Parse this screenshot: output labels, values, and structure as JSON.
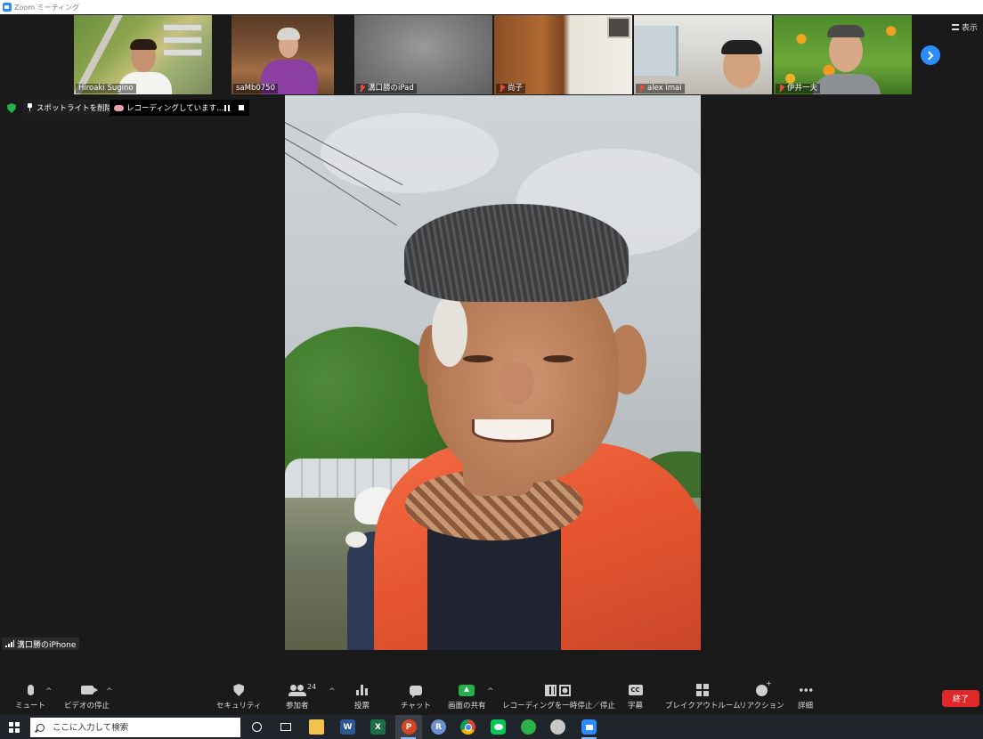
{
  "window": {
    "title": "Zoom ミーティング"
  },
  "participants": [
    {
      "name": "Hiroaki Sugino",
      "muted": false
    },
    {
      "name": "saMb0750",
      "muted": false
    },
    {
      "name": "溝口勝のiPad",
      "muted": true
    },
    {
      "name": "尚子",
      "muted": true
    },
    {
      "name": "alex imai",
      "muted": true
    },
    {
      "name": "伊井一夫",
      "muted": true
    }
  ],
  "view_button": {
    "label": "表示"
  },
  "spotlight": {
    "remove_label": "スポットライトを削除"
  },
  "recording": {
    "status": "レコーディングしています..."
  },
  "active_speaker": {
    "name": "溝口勝のiPhone"
  },
  "toolbar": {
    "mute": "ミュート",
    "stop_video": "ビデオの停止",
    "security": "セキュリティ",
    "participants": "参加者",
    "participant_count": "24",
    "polls": "投票",
    "chat": "チャット",
    "share": "画面の共有",
    "recording_control": "レコーディングを一時停止／停止",
    "captions": "字幕",
    "captions_icon_text": "CC",
    "breakout": "ブレイクアウトルーム",
    "reactions": "リアクション",
    "more": "詳細",
    "end": "終了"
  },
  "taskbar": {
    "search_placeholder": "ここに入力して検索",
    "apps": [
      {
        "name": "File Explorer",
        "icon": "folder-icon"
      },
      {
        "name": "Word",
        "icon": "word-icon",
        "glyph": "W"
      },
      {
        "name": "Excel",
        "icon": "excel-icon",
        "glyph": "X"
      },
      {
        "name": "PowerPoint",
        "icon": "powerpoint-icon",
        "glyph": "P"
      },
      {
        "name": "R",
        "icon": "r-icon",
        "glyph": "R"
      },
      {
        "name": "Chrome",
        "icon": "chrome-icon"
      },
      {
        "name": "LINE",
        "icon": "line-icon"
      },
      {
        "name": "App",
        "icon": "green-app-icon"
      },
      {
        "name": "Paint",
        "icon": "paint-icon"
      },
      {
        "name": "Zoom",
        "icon": "zoom-icon"
      }
    ]
  },
  "colors": {
    "background": "#1a1a1a",
    "accent": "#2d8cff",
    "share_green": "#22b14c",
    "end_red": "#e02828",
    "muted_red": "#e84c3d"
  }
}
